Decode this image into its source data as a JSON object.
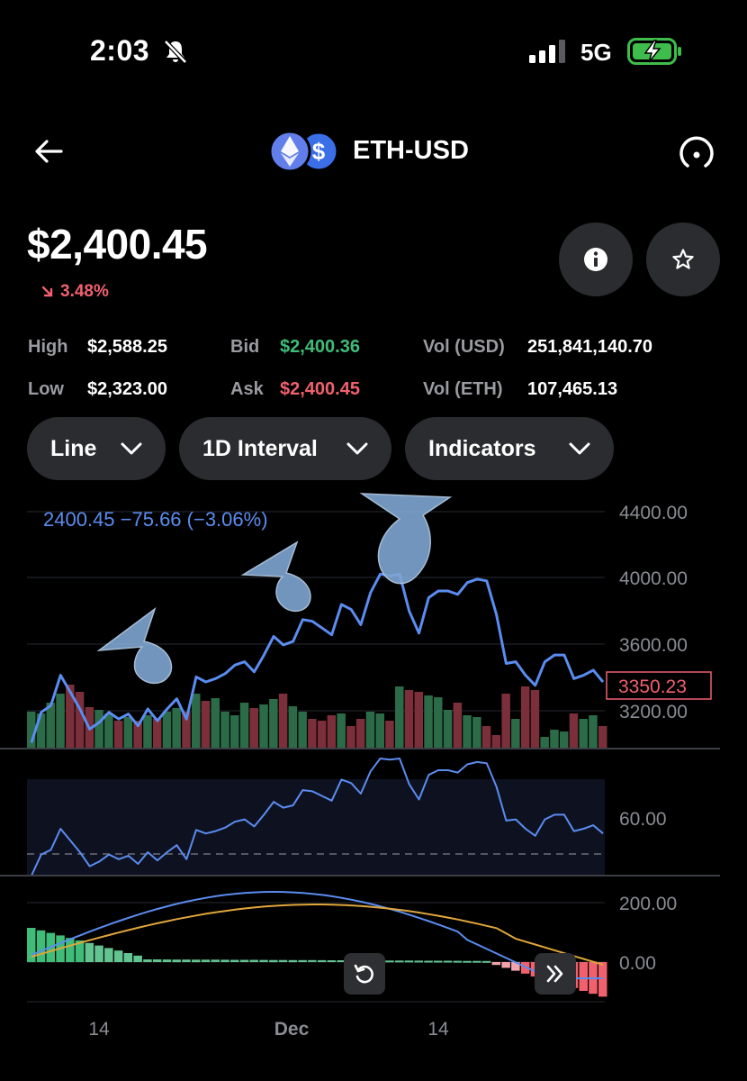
{
  "status_bar": {
    "time": "2:03",
    "network": "5G"
  },
  "header": {
    "title": "ETH-USD"
  },
  "price": {
    "value": "$2,400.45",
    "change": "3.48%"
  },
  "stats": {
    "high_label": "High",
    "high": "$2,588.25",
    "low_label": "Low",
    "low": "$2,323.00",
    "bid_label": "Bid",
    "bid": "$2,400.36",
    "ask_label": "Ask",
    "ask": "$2,400.45",
    "vol_usd_label": "Vol (USD)",
    "vol_usd": "251,841,140.70",
    "vol_eth_label": "Vol (ETH)",
    "vol_eth": "107,465.13"
  },
  "controls": {
    "chart_type": "Line",
    "interval": "1D Interval",
    "indicators": "Indicators"
  },
  "colors": {
    "line": "#5b8cf0",
    "up": "#3fbd78",
    "down": "#f0616d",
    "signal": "#e0a63b",
    "background": "#000000"
  },
  "chart_data": [
    {
      "type": "line",
      "legend": "2400.45  −75.66 (−3.06%)",
      "y_ticks": [
        "4400.00",
        "4000.00",
        "3600.00",
        "3200.00"
      ],
      "last_price_label": "3350.23",
      "x_tick_labels": [
        "14",
        "Dec",
        "14"
      ],
      "ylim": [
        2970,
        4440
      ],
      "series": [
        {
          "values": [
            3000,
            3180,
            3220,
            3400,
            3300,
            3200,
            3080,
            3120,
            3180,
            3140,
            3170,
            3100,
            3200,
            3130,
            3200,
            3260,
            3140,
            3390,
            3360,
            3380,
            3410,
            3460,
            3480,
            3420,
            3520,
            3630,
            3580,
            3600,
            3730,
            3720,
            3680,
            3640,
            3820,
            3790,
            3700,
            3890,
            4000,
            3990,
            4000,
            3780,
            3650,
            3860,
            3900,
            3900,
            3880,
            3950,
            3970,
            3960,
            3760,
            3470,
            3480,
            3400,
            3340,
            3480,
            3520,
            3520,
            3380,
            3400,
            3430,
            3360
          ]
        }
      ]
    },
    {
      "type": "bar",
      "label": "Volume"
    },
    {
      "type": "line",
      "label": "RSI",
      "y_ticks": [
        "60.00"
      ]
    },
    {
      "type": "bar",
      "label": "MACD",
      "y_ticks": [
        "200.00",
        "0.00"
      ]
    }
  ]
}
